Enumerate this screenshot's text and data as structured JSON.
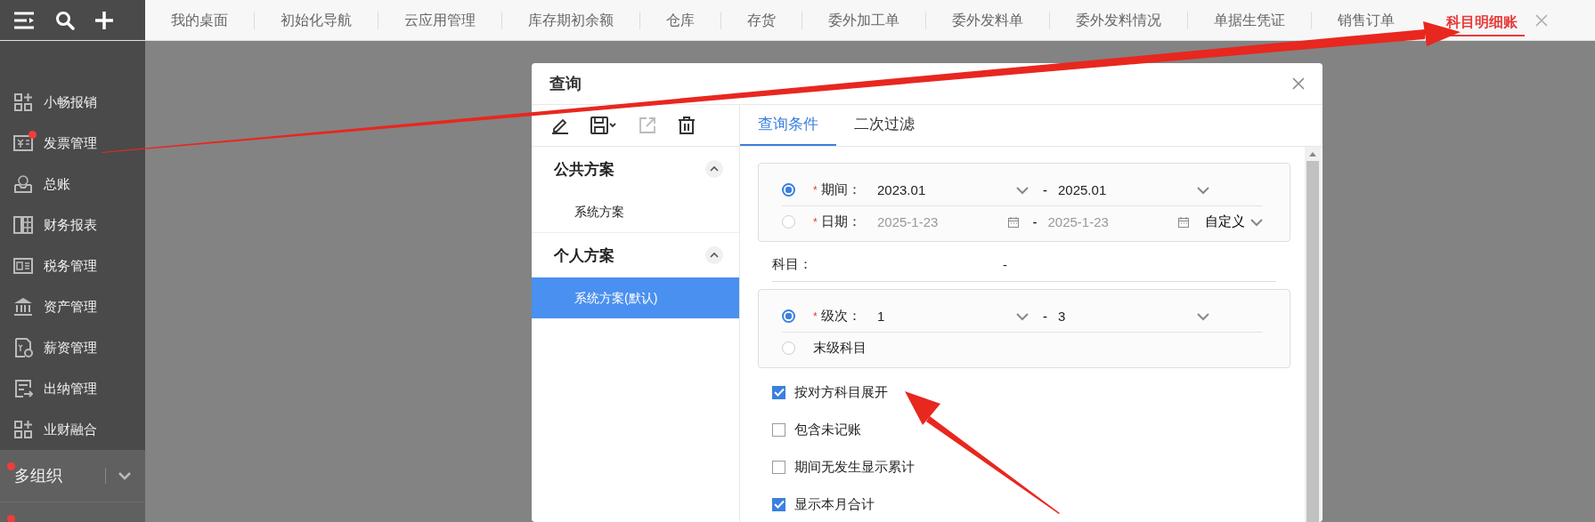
{
  "top_tabs": [
    {
      "label": "我的桌面",
      "selected": false
    },
    {
      "label": "初始化导航",
      "selected": false
    },
    {
      "label": "云应用管理",
      "selected": false
    },
    {
      "label": "库存期初余额",
      "selected": false
    },
    {
      "label": "仓库",
      "selected": false
    },
    {
      "label": "存货",
      "selected": false
    },
    {
      "label": "委外加工单",
      "selected": false
    },
    {
      "label": "委外发料单",
      "selected": false
    },
    {
      "label": "委外发料情况",
      "selected": false
    },
    {
      "label": "单据生凭证",
      "selected": false
    },
    {
      "label": "销售订单",
      "selected": false
    },
    {
      "label": "科目明细账",
      "selected": true
    }
  ],
  "sidebar": {
    "items": [
      {
        "label": "小畅报销",
        "badge": false
      },
      {
        "label": "发票管理",
        "badge": true
      },
      {
        "label": "总账",
        "badge": false
      },
      {
        "label": "财务报表",
        "badge": false
      },
      {
        "label": "税务管理",
        "badge": false
      },
      {
        "label": "资产管理",
        "badge": false
      },
      {
        "label": "薪资管理",
        "badge": false
      },
      {
        "label": "出纳管理",
        "badge": false
      },
      {
        "label": "业财融合",
        "badge": false
      }
    ],
    "org_switch": {
      "label": "多组织",
      "badge": true
    }
  },
  "dialog": {
    "title": "查询",
    "scheme_groups": [
      {
        "title": "公共方案",
        "expanded": true,
        "items": [
          {
            "label": "系统方案",
            "selected": false
          }
        ]
      },
      {
        "title": "个人方案",
        "expanded": true,
        "items": [
          {
            "label": "系统方案(默认)",
            "selected": true
          }
        ]
      }
    ],
    "tabs": [
      {
        "label": "查询条件",
        "selected": true
      },
      {
        "label": "二次过滤",
        "selected": false
      }
    ],
    "range_groups": [
      {
        "rows": [
          {
            "kind": "range",
            "selected": true,
            "required_mark": "*",
            "label": "期间：",
            "from": "2023.01",
            "separator": "-",
            "to": "2025.01"
          },
          {
            "kind": "date",
            "selected": false,
            "required_mark": "*",
            "label": "日期：",
            "from": "2025-1-23",
            "separator": "-",
            "to": "2025-1-23",
            "mode": "自定义"
          }
        ]
      },
      {
        "rows": [
          {
            "kind": "range",
            "selected": true,
            "required_mark": "*",
            "label": "级次：",
            "from": "1",
            "separator": "-",
            "to": "3"
          },
          {
            "kind": "option",
            "selected": false,
            "label": "末级科目"
          }
        ]
      }
    ],
    "account": {
      "label": "科目：",
      "separator": "-"
    },
    "checkboxes": [
      {
        "label": "按对方科目展开",
        "checked": true
      },
      {
        "label": "包含未记账",
        "checked": false
      },
      {
        "label": "期间无发生显示累计",
        "checked": false
      },
      {
        "label": "显示本月合计",
        "checked": true
      }
    ]
  }
}
